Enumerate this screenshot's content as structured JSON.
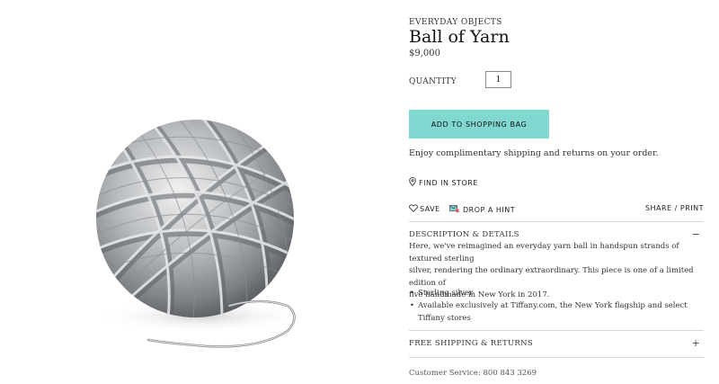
{
  "product": {
    "category": "EVERYDAY OBJECTS",
    "name": "Ball of Yarn",
    "price": "$9,000"
  },
  "quantity": {
    "label": "QUANTITY",
    "value": "1"
  },
  "actions": {
    "add_to_bag": "ADD TO SHOPPING BAG",
    "shipping_note": "Enjoy complimentary shipping and returns on your order.",
    "find_in_store": "FIND IN STORE",
    "save": "SAVE",
    "drop_hint": "DROP A HINT",
    "share": "SHARE",
    "separator": "/",
    "print": "PRINT"
  },
  "details": {
    "heading": "DESCRIPTION & DETAILS",
    "toggle": "−",
    "description_lines": [
      "Here, we've reimagined an everyday yarn ball in handspun strands of textured sterling",
      "silver, rendering the ordinary extraordinary. This piece is one of a limited edition of",
      "five handmade in New York in 2017."
    ],
    "bullets": [
      "Sterling silver",
      "Available exclusively at Tiffany.com, the New York flagship and select Tiffany stores"
    ]
  },
  "shipping_section": {
    "heading": "FREE SHIPPING & RETURNS",
    "toggle": "+"
  },
  "customer_service": "Customer Service: 800 843 3269",
  "icons": {
    "product_image": "silver-yarn-ball",
    "find_in_store": "location-pin-icon",
    "save": "heart-icon",
    "drop_hint": "gift-hint-icon"
  },
  "colors": {
    "accent": "#81d8d0"
  }
}
